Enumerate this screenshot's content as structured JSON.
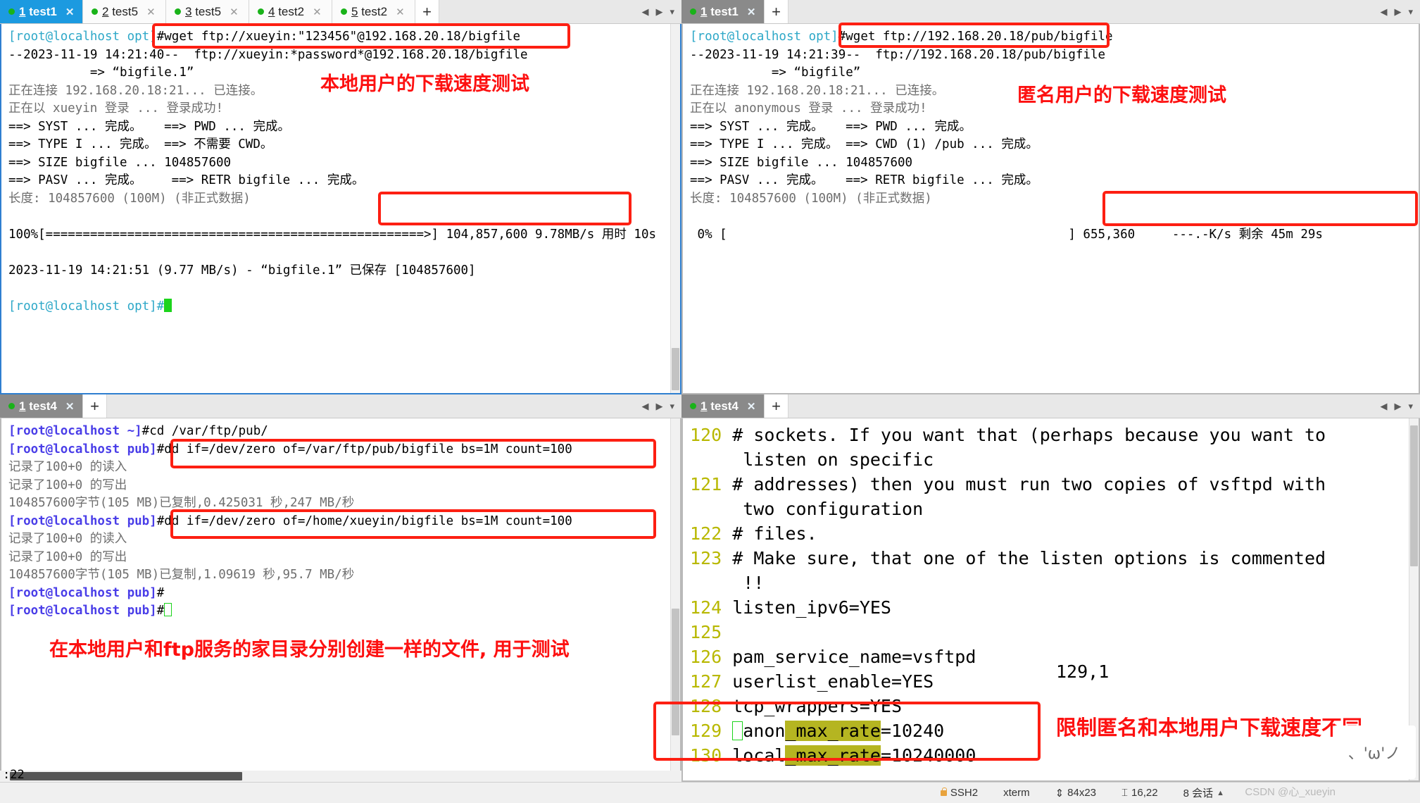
{
  "app": {
    "title": "Xshell terminal - vsftpd speed limit test"
  },
  "panes": {
    "top_left": {
      "tabs": [
        {
          "index": "1",
          "label": "test1",
          "active": true
        },
        {
          "index": "2",
          "label": "test5",
          "active": false
        },
        {
          "index": "3",
          "label": "test5",
          "active": false
        },
        {
          "index": "4",
          "label": "test2",
          "active": false
        },
        {
          "index": "5",
          "label": "test2",
          "active": false
        }
      ],
      "add_tab_label": "+",
      "lines": [
        {
          "prompt": "[root@localhost opt]",
          "cmd": "#wget ftp://xueyin:\"123456\"@192.168.20.18/bigfile"
        },
        {
          "text": "--2023-11-19 14:21:40--  ftp://xueyin:*password*@192.168.20.18/bigfile"
        },
        {
          "text": "           => “bigfile.1”"
        },
        {
          "text": "正在连接 192.168.20.18:21... 已连接。"
        },
        {
          "text": "正在以 xueyin 登录 ... 登录成功!"
        },
        {
          "text": "==> SYST ... 完成。   ==> PWD ... 完成。"
        },
        {
          "text": "==> TYPE I ... 完成。 ==> 不需要 CWD。"
        },
        {
          "text": "==> SIZE bigfile ... 104857600"
        },
        {
          "text": "==> PASV ... 完成。    ==> RETR bigfile ... 完成。"
        },
        {
          "text": "长度: 104857600 (100M) (非正式数据)"
        },
        {
          "text": ""
        },
        {
          "text": "100%[===================================================>] 104,857,600 9.78MB/s 用时 10s"
        },
        {
          "text": ""
        },
        {
          "text": "2023-11-19 14:21:51 (9.77 MB/s) - “bigfile.1” 已保存 [104857600]"
        },
        {
          "text": ""
        }
      ],
      "final_prompt": "[root@localhost opt]#"
    },
    "top_right": {
      "tabs": [
        {
          "index": "1",
          "label": "test1",
          "active": true
        }
      ],
      "add_tab_label": "+",
      "lines": [
        {
          "prompt": "[root@localhost opt]",
          "cmd": "#wget ftp://192.168.20.18/pub/bigfile"
        },
        {
          "text": "--2023-11-19 14:21:39--  ftp://192.168.20.18/pub/bigfile"
        },
        {
          "text": "           => “bigfile”"
        },
        {
          "text": "正在连接 192.168.20.18:21... 已连接。"
        },
        {
          "text": "正在以 anonymous 登录 ... 登录成功!"
        },
        {
          "text": "==> SYST ... 完成。   ==> PWD ... 完成。"
        },
        {
          "text": "==> TYPE I ... 完成。 ==> CWD (1) /pub ... 完成。"
        },
        {
          "text": "==> SIZE bigfile ... 104857600"
        },
        {
          "text": "==> PASV ... 完成。   ==> RETR bigfile ... 完成。"
        },
        {
          "text": "长度: 104857600 (100M) (非正式数据)"
        },
        {
          "text": ""
        },
        {
          "text": " 0% [                                              ] 655,360     ---.-K/s 剩余 45m 29s"
        }
      ]
    },
    "bottom_left": {
      "tabs": [
        {
          "index": "1",
          "label": "test4",
          "active": true
        }
      ],
      "add_tab_label": "+",
      "lines": [
        {
          "prompt": "[root@localhost ~]",
          "cmd": "#cd /var/ftp/pub/"
        },
        {
          "prompt": "[root@localhost pub]",
          "cmd": "#dd if=/dev/zero of=/var/ftp/pub/bigfile bs=1M count=100"
        },
        {
          "text": "记录了100+0 的读入"
        },
        {
          "text": "记录了100+0 的写出"
        },
        {
          "text": "104857600字节(105 MB)已复制,0.425031 秒,247 MB/秒"
        },
        {
          "prompt": "[root@localhost pub]",
          "cmd": "#dd if=/dev/zero of=/home/xueyin/bigfile bs=1M count=100"
        },
        {
          "text": "记录了100+0 的读入"
        },
        {
          "text": "记录了100+0 的写出"
        },
        {
          "text": "104857600字节(105 MB)已复制,1.09619 秒,95.7 MB/秒"
        },
        {
          "prompt": "[root@localhost pub]",
          "cmd": "#"
        },
        {
          "prompt": "[root@localhost pub]",
          "cmd": "#"
        }
      ]
    },
    "bottom_right": {
      "tabs": [
        {
          "index": "1",
          "label": "test4",
          "active": true
        }
      ],
      "add_tab_label": "+",
      "vim_lines": [
        {
          "no": "120",
          "text": "# sockets. If you want that (perhaps because you want to"
        },
        {
          "no": "",
          "text": "  listen on specific"
        },
        {
          "no": "121",
          "text": "# addresses) then you must run two copies of vsftpd with"
        },
        {
          "no": "",
          "text": "  two configuration"
        },
        {
          "no": "122",
          "text": "# files."
        },
        {
          "no": "123",
          "text": "# Make sure, that one of the listen options is commented"
        },
        {
          "no": "",
          "text": "  !!"
        },
        {
          "no": "124",
          "text": "listen_ipv6=YES"
        },
        {
          "no": "125",
          "text": ""
        },
        {
          "no": "126",
          "text": "pam_service_name=vsftpd"
        },
        {
          "no": "127",
          "text": "userlist_enable=YES"
        },
        {
          "no": "128",
          "text": "tcp_wrappers=YES"
        },
        {
          "no": "129",
          "text": "anon_max_rate=10240"
        },
        {
          "no": "130",
          "text": "local_max_rate=10240000"
        }
      ],
      "cursor_position": "129,1"
    }
  },
  "annotations": [
    {
      "id": "a1",
      "text": "本地用户的下载速度测试"
    },
    {
      "id": "a2",
      "text": "匿名用户的下载速度测试"
    },
    {
      "id": "a3",
      "text": "在本地用户和ftp服务的家目录分别创建一样的文件, 用于测试"
    },
    {
      "id": "a4",
      "text": "限制匿名和本地用户下载速度不同"
    }
  ],
  "statusbar": {
    "left_text": ":22",
    "ssh": "SSH2",
    "term_type": "xterm",
    "size": "84x23",
    "cursor": "16,22",
    "sessions": "8 会话",
    "arrow": "▲",
    "watermark": "CSDN @心_xueyin",
    "kaomoji": "、'ω'ノ"
  },
  "colors": {
    "accent_blue": "#1c9ae0",
    "annotation_red": "#fd1010",
    "prompt_cyan": "#2ea8c8",
    "prompt_blue": "#4a3ee8",
    "highlight_yellow": "#b5b521",
    "vim_line_number": "#b8b800"
  }
}
